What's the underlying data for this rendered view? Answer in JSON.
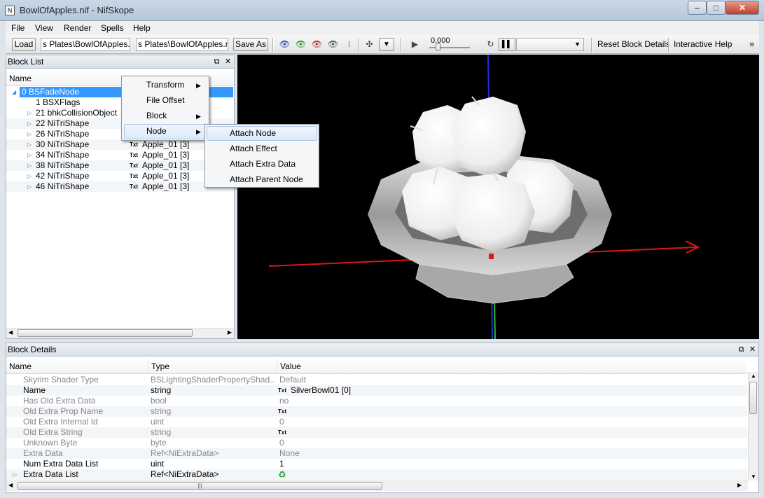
{
  "window": {
    "title": "BowlOfApples.nif - NifSkope",
    "app_icon": "nifskope-icon",
    "min": "–",
    "max": "□",
    "close": "✕"
  },
  "menu": [
    "File",
    "View",
    "Render",
    "Spells",
    "Help"
  ],
  "toolbar": {
    "load_label": "Load",
    "load_path": "s Plates\\BowlOfApples.nif",
    "save_path": "s Plates\\BowlOfApples.nif",
    "save_as_label": "Save As",
    "time_value": "0.000",
    "reset_label": "Reset Block Details",
    "help_label": "Interactive Help",
    "more": "»"
  },
  "block_list": {
    "title": "Block List",
    "col_name": "Name",
    "rows": [
      {
        "label": "0 BSFadeNode",
        "value": ""
      },
      {
        "label": "1 BSXFlags",
        "value": ""
      },
      {
        "label": "21 bhkCollisionObject",
        "value": ""
      },
      {
        "label": "22 NiTriShape",
        "value": ""
      },
      {
        "label": "26 NiTriShape",
        "value": ""
      },
      {
        "label": "30 NiTriShape",
        "value": "Apple_01 [3]"
      },
      {
        "label": "34 NiTriShape",
        "value": "Apple_01 [3]"
      },
      {
        "label": "38 NiTriShape",
        "value": "Apple_01 [3]"
      },
      {
        "label": "42 NiTriShape",
        "value": "Apple_01 [3]"
      },
      {
        "label": "46 NiTriShape",
        "value": "Apple_01 [3]"
      }
    ],
    "txt_badge": "Txt"
  },
  "context_menu": {
    "items": [
      "Transform",
      "File Offset",
      "Block",
      "Node"
    ],
    "submenu": [
      "Attach Node",
      "Attach Effect",
      "Attach Extra Data",
      "Attach Parent Node"
    ]
  },
  "block_details": {
    "title": "Block Details",
    "cols": {
      "name": "Name",
      "type": "Type",
      "value": "Value"
    },
    "rows": [
      {
        "name": "Skyrim Shader Type",
        "type": "BSLightingShaderPropertyShad...",
        "value": "Default"
      },
      {
        "name": "Name",
        "type": "string",
        "value": "SilverBowl01 [0]"
      },
      {
        "name": "Has Old Extra Data",
        "type": "bool",
        "value": "no"
      },
      {
        "name": "Old Extra Prop Name",
        "type": "string",
        "value": ""
      },
      {
        "name": "Old Extra Internal Id",
        "type": "uint",
        "value": "0"
      },
      {
        "name": "Old Extra String",
        "type": "string",
        "value": ""
      },
      {
        "name": "Unknown Byte",
        "type": "byte",
        "value": "0"
      },
      {
        "name": "Extra Data",
        "type": "Ref<NiExtraData>",
        "value": "None"
      },
      {
        "name": "Num Extra Data List",
        "type": "uint",
        "value": "1"
      },
      {
        "name": "Extra Data List",
        "type": "Ref<NiExtraData>",
        "value": ""
      }
    ],
    "scroll_grip": "|||"
  },
  "colors": {
    "axis_x": "#e01515",
    "axis_y": "#2a2ae0",
    "axis_z": "#20c020",
    "selection": "#3399ff",
    "viewport_bg": "#000000"
  }
}
